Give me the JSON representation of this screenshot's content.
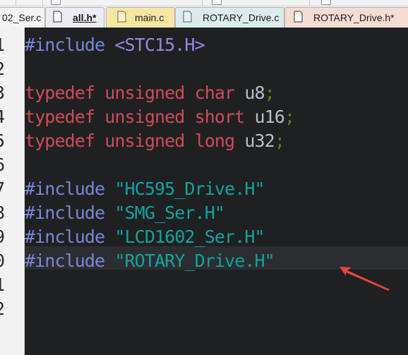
{
  "colors": {
    "editor_bg": "#1e2022",
    "current_line_bg": "#2b2d30",
    "directive": "#7b86d6",
    "header_angle": "#9a86e0",
    "string": "#11a39e",
    "keyword": "#d24b58",
    "identifier": "#b9bfc6",
    "semicolon": "#6a7a1f",
    "annotation_arrow": "#e8453c"
  },
  "tabs": [
    {
      "label": "02_Ser.c",
      "icon": "c-file-icon",
      "active": false
    },
    {
      "label": "all.h*",
      "icon": "h-file-icon",
      "active": true
    },
    {
      "label": "main.c",
      "icon": "c-file-icon",
      "active": false
    },
    {
      "label": "ROTARY_Drive.c",
      "icon": "c-file-icon",
      "active": false
    },
    {
      "label": "ROTARY_Drive.h*",
      "icon": "h-file-icon",
      "active": false
    }
  ],
  "line_numbers": [
    "1",
    "2",
    "3",
    "4",
    "5",
    "6",
    "7",
    "8",
    "9",
    "0",
    "1",
    "2"
  ],
  "code": {
    "l1": {
      "directive": "#include",
      "header": "<STC15.H>"
    },
    "l3": {
      "kw": "typedef unsigned char",
      "name": "u8",
      "semi": ";"
    },
    "l4": {
      "kw": "typedef unsigned short",
      "name": "u16",
      "semi": ";"
    },
    "l5": {
      "kw": "typedef unsigned long",
      "name": "u32",
      "semi": ";"
    },
    "l7": {
      "directive": "#include",
      "header": "\"HC595_Drive.H\""
    },
    "l8": {
      "directive": "#include",
      "header": "\"SMG_Ser.H\""
    },
    "l9": {
      "directive": "#include",
      "header": "\"LCD1602_Ser.H\""
    },
    "l10": {
      "directive": "#include",
      "header": "\"ROTARY_Drive.H\""
    }
  }
}
